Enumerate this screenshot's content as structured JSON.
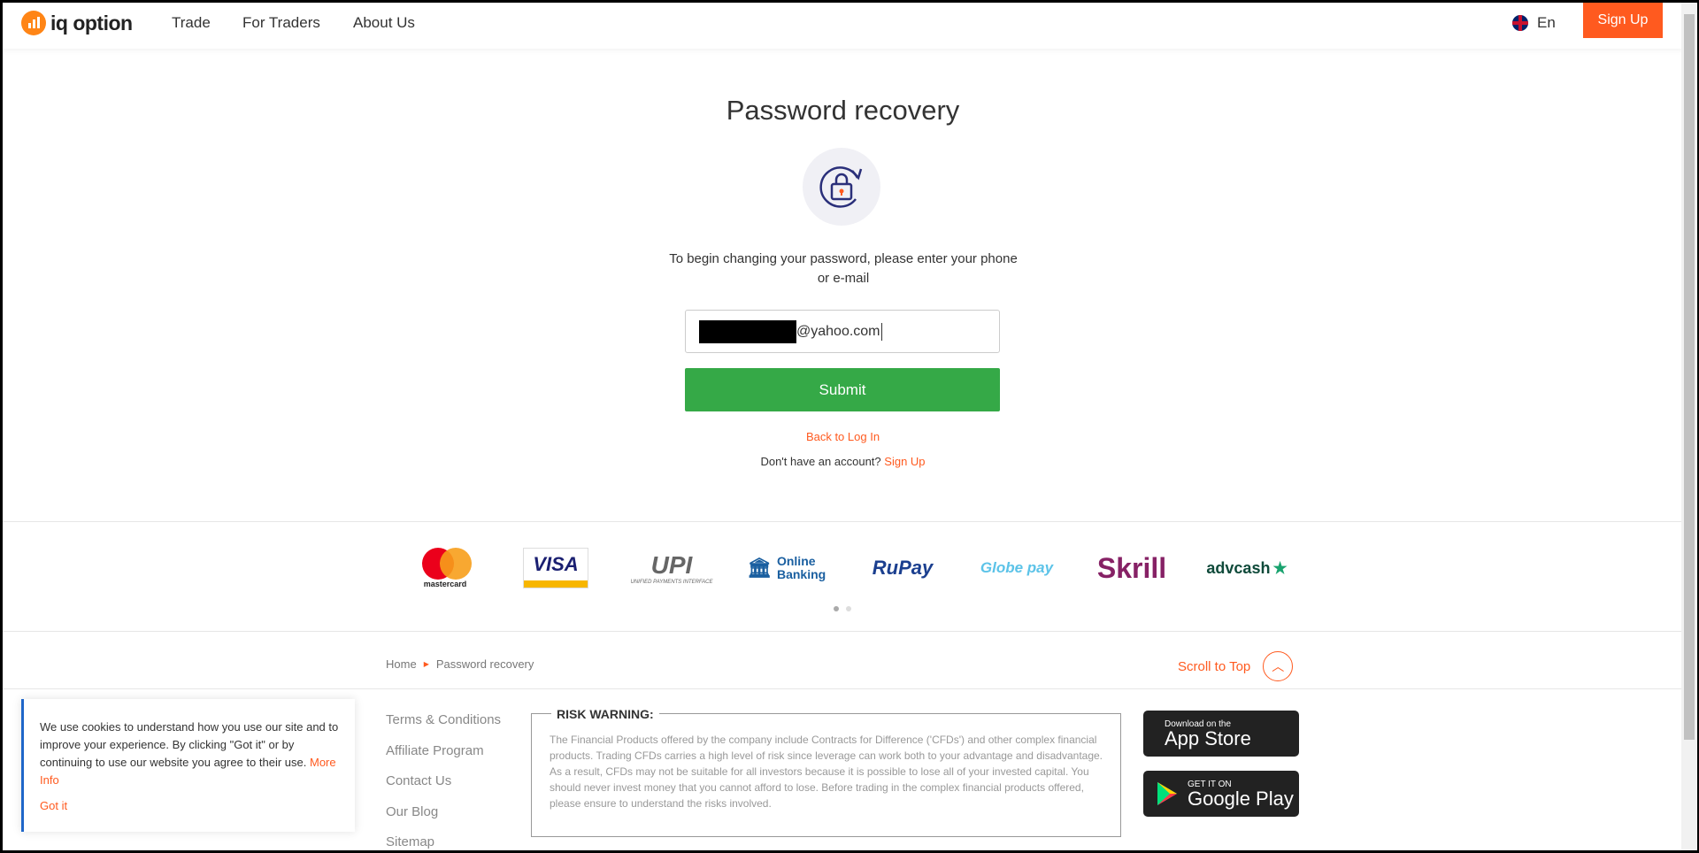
{
  "header": {
    "logo": "iq option",
    "nav": [
      "Trade",
      "For Traders",
      "About Us"
    ],
    "lang": "En",
    "signup": "Sign Up"
  },
  "main": {
    "title": "Password recovery",
    "intro": "To begin changing your password, please enter your phone or e-mail",
    "input_value": "@yahoo.com",
    "submit": "Submit",
    "back": "Back to Log In",
    "no_account": "Don't have an account?",
    "signup": "Sign Up"
  },
  "payments": [
    "mastercard",
    "VISA",
    "UPI",
    "Online Banking",
    "RuPay",
    "Globe pay",
    "Skrill",
    "advcash"
  ],
  "payments_sub": {
    "upi": "UNIFIED PAYMENTS INTERFACE"
  },
  "breadcrumb": [
    "Home",
    "Password recovery"
  ],
  "scroll_top": "Scroll to Top",
  "footer": {
    "links": [
      "Terms & Conditions",
      "Affiliate Program",
      "Contact Us",
      "Our Blog",
      "Sitemap"
    ],
    "risk_title": "RISK WARNING:",
    "risk_text": "The Financial Products offered by the company include Contracts for Difference ('CFDs') and other complex financial products. Trading CFDs carries a high level of risk since leverage can work both to your advantage and disadvantage. As a result, CFDs may not be suitable for all investors because it is possible to lose all of your invested capital. You should never invest money that you cannot afford to lose. Before trading in the complex financial products offered, please ensure to understand the risks involved.",
    "appstore": {
      "small": "Download on the",
      "big": "App Store"
    },
    "googleplay": {
      "small": "GET IT ON",
      "big": "Google Play"
    }
  },
  "cookie": {
    "text": "We use cookies to understand how you use our site and to improve your experience. By clicking \"Got it\" or by continuing to use our website you agree to their use.",
    "more": "More Info",
    "got_it": "Got it"
  },
  "colors": {
    "accent": "#ff5a1f",
    "submit": "#35a947"
  }
}
